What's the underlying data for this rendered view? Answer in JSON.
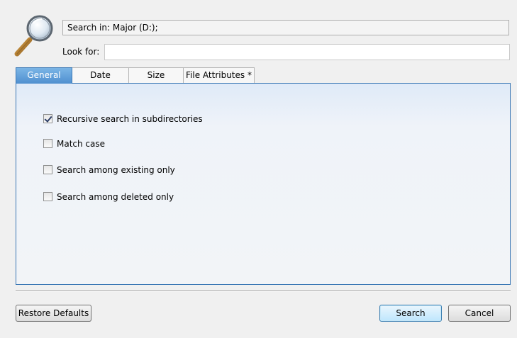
{
  "header": {
    "search_in": "Search in: Major (D:);",
    "look_for_label": "Look for:",
    "look_for_value": ""
  },
  "tabs": [
    {
      "label": "General",
      "active": true
    },
    {
      "label": "Date",
      "active": false
    },
    {
      "label": "Size",
      "active": false
    },
    {
      "label": "File Attributes *",
      "active": false
    }
  ],
  "general": {
    "options": [
      {
        "label": "Recursive search in subdirectories",
        "checked": true
      },
      {
        "label": "Match case",
        "checked": false
      },
      {
        "label": "Search among existing only",
        "checked": false
      },
      {
        "label": "Search among deleted only",
        "checked": false
      }
    ]
  },
  "buttons": {
    "restore": "Restore Defaults",
    "search": "Search",
    "cancel": "Cancel"
  },
  "colors": {
    "accent": "#4f8fcf",
    "panel_top": "#dfeaf8",
    "window": "#f0f0f0"
  },
  "icons": {
    "magnifier": "magnifier-icon",
    "checkbox_checked": "checkmark-icon"
  }
}
